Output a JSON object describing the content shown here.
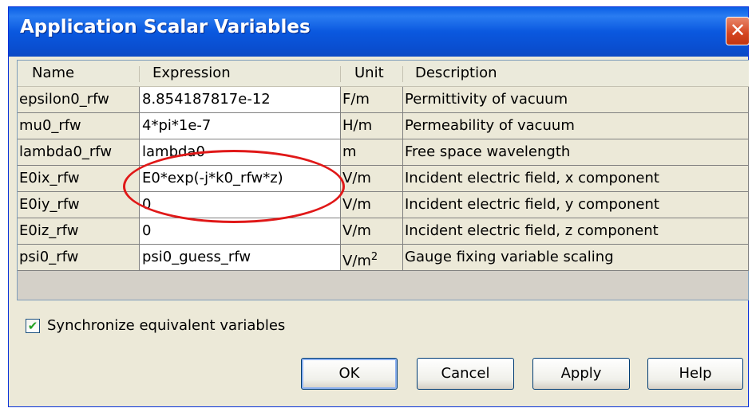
{
  "dialog": {
    "title": "Application Scalar Variables",
    "close_glyph": "✕"
  },
  "table": {
    "columns": [
      "Name",
      "Expression",
      "Unit",
      "Description"
    ],
    "rows": [
      {
        "name": "epsilon0_rfw",
        "expression": "8.854187817e-12",
        "unit": "F/m",
        "unit_sup": "",
        "description": "Permittivity of vacuum"
      },
      {
        "name": "mu0_rfw",
        "expression": "4*pi*1e-7",
        "unit": "H/m",
        "unit_sup": "",
        "description": "Permeability of vacuum"
      },
      {
        "name": "lambda0_rfw",
        "expression": "lambda0",
        "unit": "m",
        "unit_sup": "",
        "description": "Free space wavelength"
      },
      {
        "name": "E0ix_rfw",
        "expression": "E0*exp(-j*k0_rfw*z)",
        "unit": "V/m",
        "unit_sup": "",
        "description": "Incident electric field, x component"
      },
      {
        "name": "E0iy_rfw",
        "expression": "0",
        "unit": "V/m",
        "unit_sup": "",
        "description": "Incident electric field, y component"
      },
      {
        "name": "E0iz_rfw",
        "expression": "0",
        "unit": "V/m",
        "unit_sup": "",
        "description": "Incident electric field, z component"
      },
      {
        "name": "psi0_rfw",
        "expression": "psi0_guess_rfw",
        "unit": "V/m",
        "unit_sup": "2",
        "description": "Gauge fixing variable scaling"
      }
    ]
  },
  "options": {
    "synchronize_label": "Synchronize equivalent variables",
    "synchronize_checked": true,
    "check_glyph": "✔"
  },
  "buttons": {
    "ok": "OK",
    "cancel": "Cancel",
    "apply": "Apply",
    "help": "Help"
  },
  "colors": {
    "titlebar": "#0a58df",
    "annotation_oval": "#e01818"
  }
}
